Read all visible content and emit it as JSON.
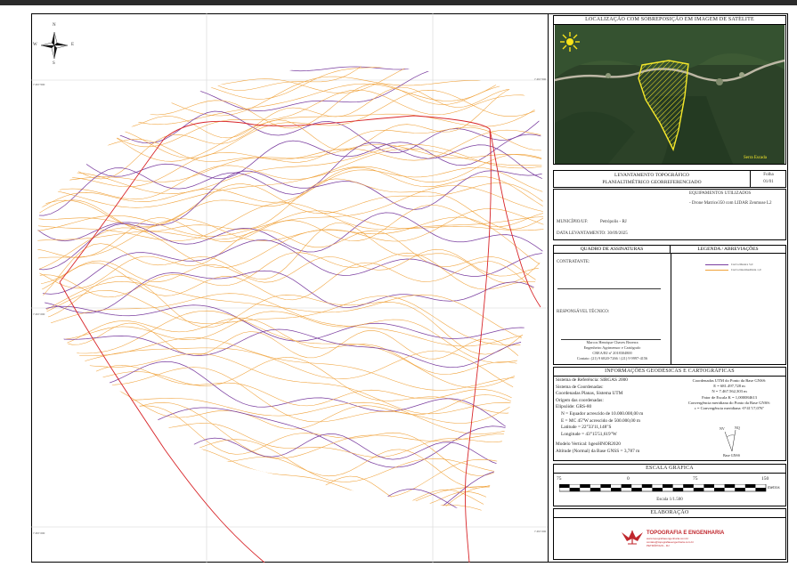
{
  "satellite_panel": {
    "title": "LOCALIZAÇÃO COM SOBREPOSIÇÃO EM IMAGEM DE SATÉLITE",
    "place_label": "Serra Escada",
    "colors": {
      "polygon": "#f5e82a",
      "vegetation": "#2f4a2a",
      "road": "#bdb7a5"
    }
  },
  "title_block": {
    "line1": "LEVANTAMENTO TOPOGRÁFICO",
    "line2": "PLANIALTIMÉTRICO GEORREFERENCIADO",
    "sheet_label": "Folha",
    "sheet_value": "01/01"
  },
  "info": {
    "municipio_label": "MUNICÍPIO/UF:",
    "municipio_value": "Petrópolis - RJ",
    "data_label": "DATA LEVANTAMENTO:",
    "data_value": "30/09/2025",
    "equip_label": "EQUIPAMENTOS UTILIZADOS",
    "equip_value": "- Drone Matrice350 com LIDAR Zenmuse L2"
  },
  "signatures": {
    "title": "QUADRO DE ASSINATURAS",
    "contratante": "CONTRATANTE:",
    "responsavel": "RESPONSÁVEL TÉCNICO:",
    "name": "Marcos Henrique Chaves Bezerra",
    "role": "Engenheiro Agrimensor e Cartógrafo",
    "crea": "CREA/RJ nº 2018304800",
    "contact": "Contato: (21) 9 6820-7266 / (21) 9 9997-4156"
  },
  "legend": {
    "title": "LEGENDA / ABREVIAÇÕES",
    "items": [
      {
        "label": "Curva Mestra 5,0",
        "color": "#7b3fa0"
      },
      {
        "label": "Curva Intermediária 1,0",
        "color": "#f0a23a"
      }
    ]
  },
  "geo": {
    "title": "INFORMAÇÕES GEODÉSICAS E CARTOGRÁFICAS",
    "left": [
      "Sistema de Referência: SIRGAS 2000",
      "Sistema de Coordenadas:",
      "Coordenadas Planas, Sistema UTM",
      "Origem das coordenadas:",
      "Elipsóide: GRS-80",
      "N = Equador acrescido de 10.000.000,00 m",
      "E = MC 45°W acrescido de 500.000,00 m",
      "Latitude = 22°33'11,148\"S",
      "Longitude = 43°15'51,619\"W",
      "Modelo Vertical: hgeoHNOR2020",
      "Altitude (Normal) da Base GNSS = 3,787 m"
    ],
    "right": [
      "Coordenadas UTM do Ponto da Base GNSS:",
      "E = 681.497,728 m",
      "N = 7.467.562,303 m",
      "Fator de Escala K = 1,000084613",
      "Convergência meridiana do Ponto da Base GNSS:",
      "c = Convergência meridiana -0°41'17,076\""
    ],
    "nv": "NV",
    "nq": "NQ",
    "base": "Base GNSS"
  },
  "scale": {
    "title": "ESCALA GRÁFICA",
    "ticks": [
      "75",
      "0",
      "75",
      "150"
    ],
    "unit": "metros",
    "text": "Escala 1/1.500"
  },
  "elaboracao": {
    "title": "ELABORAÇÃO",
    "company": "TOPOGRAFIA E ENGENHARIA",
    "line1": "www.topografiaeengenharia.com.br",
    "line2": "contato@topografiaeengenharia.com.br",
    "line3": "PETRÓPOLIS - RJ"
  },
  "compass": {
    "n": "N",
    "s": "S",
    "e": "E",
    "w": "W"
  },
  "map": {
    "grid_labels": [
      "681.000",
      "681.500",
      "682.000",
      "7.467.500",
      "7.467.000"
    ],
    "colors": {
      "master": "#7b3fa0",
      "intermediate": "#f0a23a",
      "boundary": "#d8262a"
    }
  }
}
